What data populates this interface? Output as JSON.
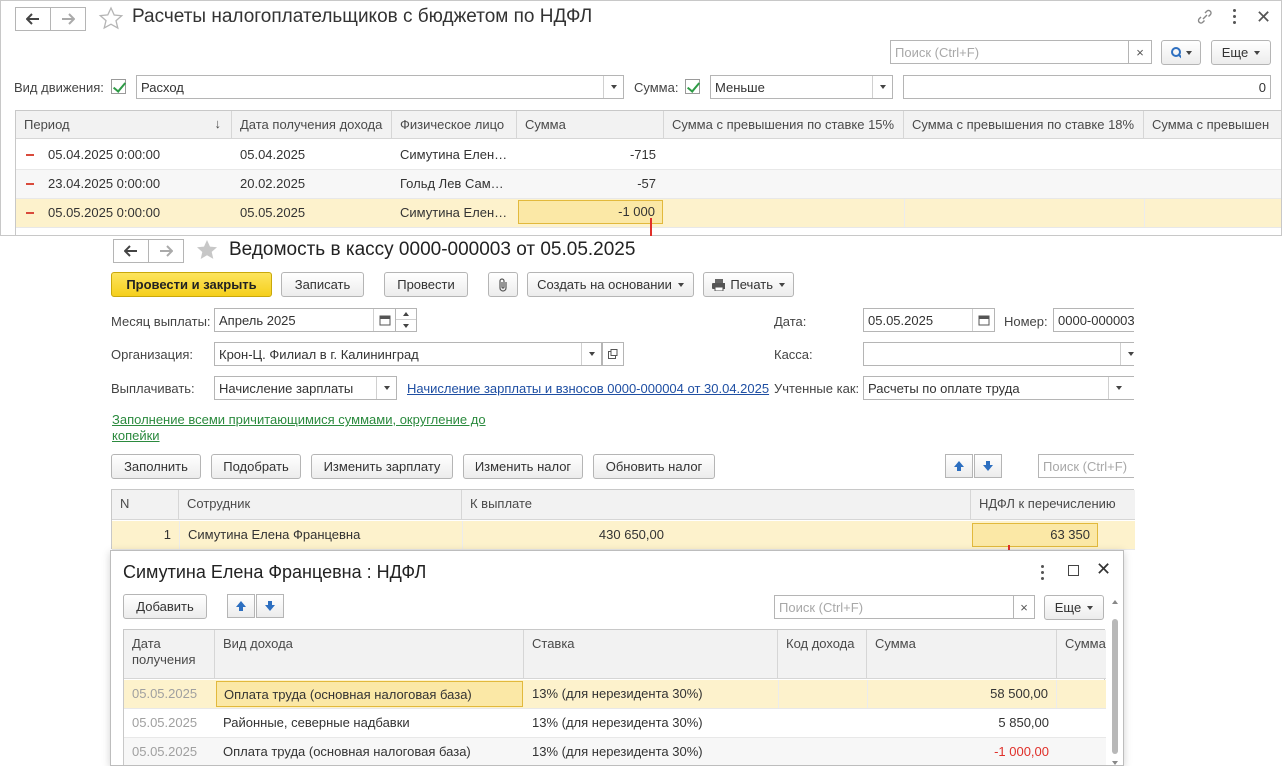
{
  "win1": {
    "title": "Расчеты налогоплательщиков с бюджетом по НДФЛ",
    "search_placeholder": "Поиск (Ctrl+F)",
    "more_label": "Еще",
    "filter": {
      "movement_label": "Вид движения:",
      "movement_value": "Расход",
      "sum_label": "Сумма:",
      "sum_cond": "Меньше",
      "sum_value": "0"
    },
    "columns": [
      "Период",
      "Дата получения дохода",
      "Физическое лицо",
      "Сумма",
      "Сумма с превышения по ставке 15%",
      "Сумма с превышения по ставке 18%",
      "Сумма с превышен"
    ],
    "rows": [
      {
        "period": "05.04.2025 0:00:00",
        "date": "05.04.2025",
        "person": "Симутина Елен…",
        "sum": "-715"
      },
      {
        "period": "23.04.2025 0:00:00",
        "date": "20.02.2025",
        "person": "Гольд Лев Сам…",
        "sum": "-57"
      },
      {
        "period": "05.05.2025 0:00:00",
        "date": "05.05.2025",
        "person": "Симутина Елен…",
        "sum": "-1 000"
      }
    ]
  },
  "win2": {
    "title": "Ведомость в кассу 0000-000003 от 05.05.2025",
    "toolbar": {
      "post_close": "Провести и закрыть",
      "save": "Записать",
      "post": "Провести",
      "create_based": "Создать на основании",
      "print": "Печать"
    },
    "form": {
      "month_label": "Месяц выплаты:",
      "month_value": "Апрель 2025",
      "date_label": "Дата:",
      "date_value": "05.05.2025",
      "number_label": "Номер:",
      "number_value": "0000-000003",
      "org_label": "Организация:",
      "org_value": "Крон-Ц. Филиал в г. Калининград",
      "cash_label": "Касса:",
      "cash_value": "",
      "pay_label": "Выплачивать:",
      "pay_value": "Начисление зарплаты",
      "pay_link": "Начисление зарплаты и взносов 0000-000004 от 30.04.2025",
      "account_label": "Учтенные как:",
      "account_value": "Расчеты по оплате труда",
      "fill_link_1": "Заполнение всеми причитающимися суммами, округление до",
      "fill_link_2": "копейки"
    },
    "buttons": {
      "fill": "Заполнить",
      "pick": "Подобрать",
      "change_salary": "Изменить зарплату",
      "change_tax": "Изменить налог",
      "update_tax": "Обновить налог"
    },
    "search_placeholder": "Поиск (Ctrl+F)",
    "columns": [
      "N",
      "Сотрудник",
      "К выплате",
      "НДФЛ к перечислению"
    ],
    "rows": [
      {
        "n": "1",
        "employee": "Симутина Елена Францевна",
        "pay": "430 650,00",
        "tax": "63 350"
      }
    ]
  },
  "win3": {
    "title": "Симутина Елена Францевна : НДФЛ",
    "add_label": "Добавить",
    "search_placeholder": "Поиск (Ctrl+F)",
    "more_label": "Еще",
    "columns": {
      "date_line1": "Дата",
      "date_line2": "получения",
      "kind": "Вид дохода",
      "rate": "Ставка",
      "code": "Код дохода",
      "sum": "Сумма",
      "sum2": "Сумма"
    },
    "rows": [
      {
        "date": "05.05.2025",
        "kind": "Оплата труда (основная налоговая база)",
        "rate": "13% (для нерезидента 30%)",
        "code": "",
        "sum": "58 500,00"
      },
      {
        "date": "05.05.2025",
        "kind": "Районные, северные надбавки",
        "rate": "13% (для нерезидента 30%)",
        "code": "",
        "sum": "5 850,00"
      },
      {
        "date": "05.05.2025",
        "kind": "Оплата труда (основная налоговая база)",
        "rate": "13% (для нерезидента 30%)",
        "code": "",
        "sum": "-1 000,00"
      }
    ]
  },
  "colors": {
    "accent_yellow": "#f5cf1c",
    "selection": "#fbe8a6",
    "annotation_red": "#e0302a",
    "negative": "#e0302a",
    "link_blue": "#1f4fa3",
    "link_green": "#2b8a3e"
  }
}
